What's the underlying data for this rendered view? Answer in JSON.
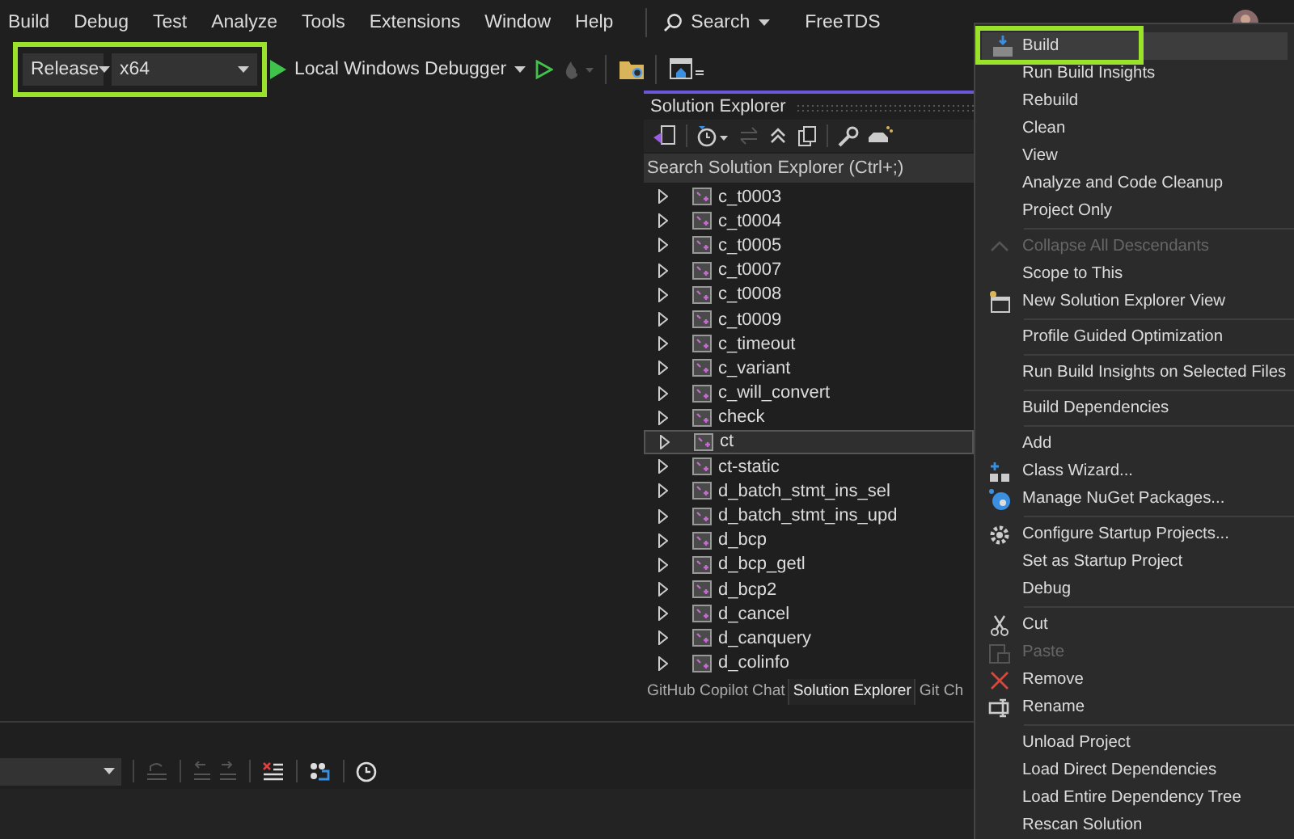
{
  "menu_bar": {
    "items": [
      "Build",
      "Debug",
      "Test",
      "Analyze",
      "Tools",
      "Extensions",
      "Window",
      "Help"
    ],
    "search": "Search",
    "solution_name": "FreeTDS"
  },
  "toolbar": {
    "configuration": "Release",
    "platform": "x64",
    "highlighted": true,
    "debugger": "Local Windows Debugger"
  },
  "solution_explorer": {
    "title": "Solution Explorer",
    "search": {
      "placeholder": "Search Solution Explorer (Ctrl+;)"
    },
    "items": [
      {
        "label": "c_t0003",
        "selected": false
      },
      {
        "label": "c_t0004",
        "selected": false
      },
      {
        "label": "c_t0005",
        "selected": false
      },
      {
        "label": "c_t0007",
        "selected": false
      },
      {
        "label": "c_t0008",
        "selected": false
      },
      {
        "label": "c_t0009",
        "selected": false
      },
      {
        "label": "c_timeout",
        "selected": false
      },
      {
        "label": "c_variant",
        "selected": false
      },
      {
        "label": "c_will_convert",
        "selected": false
      },
      {
        "label": "check",
        "selected": false
      },
      {
        "label": "ct",
        "selected": true
      },
      {
        "label": "ct-static",
        "selected": false
      },
      {
        "label": "d_batch_stmt_ins_sel",
        "selected": false
      },
      {
        "label": "d_batch_stmt_ins_upd",
        "selected": false
      },
      {
        "label": "d_bcp",
        "selected": false
      },
      {
        "label": "d_bcp_getl",
        "selected": false
      },
      {
        "label": "d_bcp2",
        "selected": false
      },
      {
        "label": "d_cancel",
        "selected": false
      },
      {
        "label": "d_canquery",
        "selected": false
      },
      {
        "label": "d_colinfo",
        "selected": false
      }
    ]
  },
  "panel_tabs": [
    {
      "label": "GitHub Copilot Chat",
      "selected": false
    },
    {
      "label": "Solution Explorer",
      "selected": true
    },
    {
      "label": "Git Ch",
      "selected": false
    }
  ],
  "context_menu": {
    "groups": [
      [
        {
          "label": "Build",
          "kind": "build",
          "disabled": false,
          "selected": true
        },
        {
          "label": "Run Build Insights",
          "kind": "plain",
          "disabled": false,
          "selected": false
        },
        {
          "label": "Rebuild",
          "kind": "plain",
          "disabled": false,
          "selected": false
        },
        {
          "label": "Clean",
          "kind": "plain",
          "disabled": false,
          "selected": false
        },
        {
          "label": "View",
          "kind": "plain",
          "disabled": false,
          "selected": false
        },
        {
          "label": "Analyze and Code Cleanup",
          "kind": "plain",
          "disabled": false,
          "selected": false
        },
        {
          "label": "Project Only",
          "kind": "plain",
          "disabled": false,
          "selected": false
        }
      ],
      [
        {
          "label": "Collapse All Descendants",
          "kind": "collapse",
          "disabled": true,
          "selected": false
        },
        {
          "label": "Scope to This",
          "kind": "plain",
          "disabled": false,
          "selected": false
        },
        {
          "label": "New Solution Explorer View",
          "kind": "new-view",
          "disabled": false,
          "selected": false
        }
      ],
      [
        {
          "label": "Profile Guided Optimization",
          "kind": "plain",
          "disabled": false,
          "selected": false
        }
      ],
      [
        {
          "label": "Run Build Insights on Selected Files",
          "kind": "plain",
          "disabled": false,
          "selected": false
        }
      ],
      [
        {
          "label": "Build Dependencies",
          "kind": "plain",
          "disabled": false,
          "selected": false
        }
      ],
      [
        {
          "label": "Add",
          "kind": "plain",
          "disabled": false,
          "selected": false
        },
        {
          "label": "Class Wizard...",
          "kind": "wizard",
          "disabled": false,
          "selected": false
        },
        {
          "label": "Manage NuGet Packages...",
          "kind": "nuget",
          "disabled": false,
          "selected": false
        }
      ],
      [
        {
          "label": "Configure Startup Projects...",
          "kind": "gear",
          "disabled": false,
          "selected": false
        },
        {
          "label": "Set as Startup Project",
          "kind": "plain",
          "disabled": false,
          "selected": false
        },
        {
          "label": "Debug",
          "kind": "plain",
          "disabled": false,
          "selected": false
        }
      ],
      [
        {
          "label": "Cut",
          "kind": "cut",
          "disabled": false,
          "selected": false
        },
        {
          "label": "Paste",
          "kind": "paste",
          "disabled": true,
          "selected": false
        },
        {
          "label": "Remove",
          "kind": "remove",
          "disabled": false,
          "selected": false
        },
        {
          "label": "Rename",
          "kind": "rename",
          "disabled": false,
          "selected": false
        }
      ],
      [
        {
          "label": "Unload Project",
          "kind": "plain",
          "disabled": false,
          "selected": false
        },
        {
          "label": "Load Direct Dependencies",
          "kind": "plain",
          "disabled": false,
          "selected": false
        },
        {
          "label": "Load Entire Dependency Tree",
          "kind": "plain",
          "disabled": false,
          "selected": false
        },
        {
          "label": "Rescan Solution",
          "kind": "plain",
          "disabled": false,
          "selected": false
        }
      ]
    ]
  }
}
